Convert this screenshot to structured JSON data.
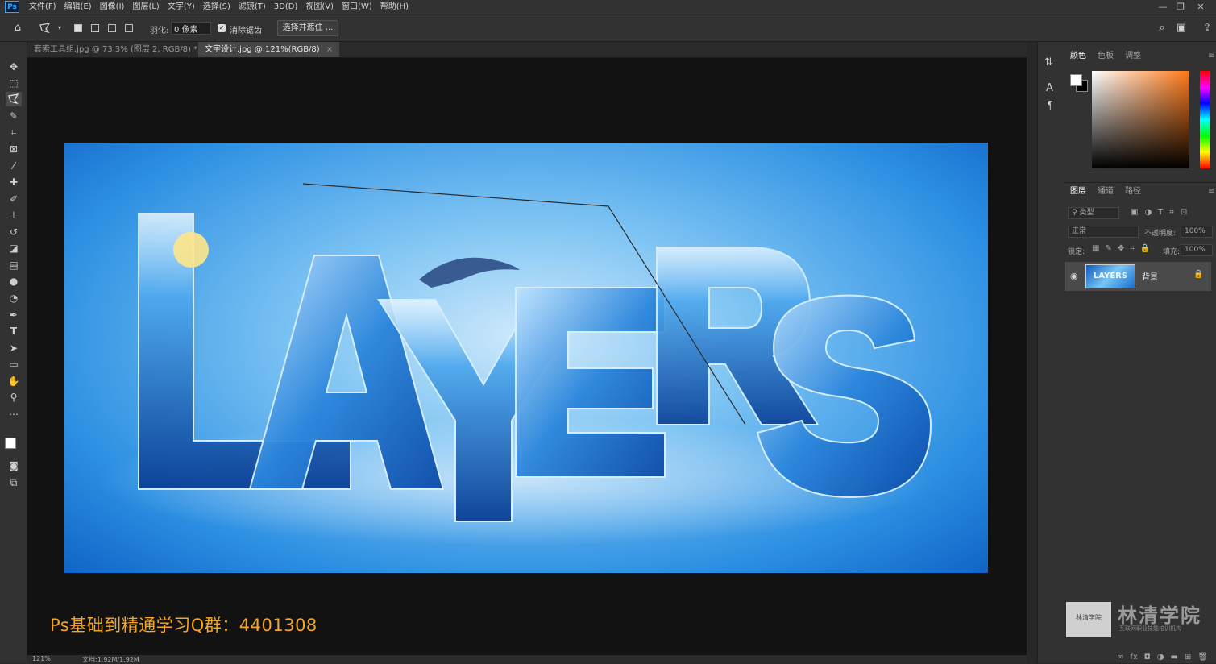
{
  "menubar": {
    "logo": "Ps",
    "items": [
      "文件(F)",
      "编辑(E)",
      "图像(I)",
      "图层(L)",
      "文字(Y)",
      "选择(S)",
      "滤镜(T)",
      "3D(D)",
      "视图(V)",
      "窗口(W)",
      "帮助(H)"
    ],
    "window_controls": [
      "—",
      "❐",
      "✕"
    ]
  },
  "options_bar": {
    "feather_label": "羽化:",
    "feather_value": "0 像素",
    "antialias_label": "消除锯齿",
    "antialias_checked": true,
    "select_mask_button": "选择并遮住 ..."
  },
  "documents": {
    "tabs": [
      {
        "label": "套索工具组.jpg @ 73.3% (图层 2, RGB/8) *",
        "active": false
      },
      {
        "label": "文字设计.jpg @ 121%(RGB/8)",
        "active": true
      }
    ],
    "close_glyph": "×"
  },
  "canvas": {
    "overlay_text": "Ps基础到精通学习Q群：4401308",
    "artwork_word": "LAYERS"
  },
  "status": {
    "zoom": "121%",
    "doc_size": "文档:1.92M/1.92M"
  },
  "color_panel": {
    "tabs": [
      "颜色",
      "色板",
      "调整"
    ],
    "active_tab": "颜色",
    "foreground": "#ffffff",
    "background": "#000000",
    "picker_hue": "#ff7a18"
  },
  "layers_panel": {
    "tabs": [
      "图层",
      "通道",
      "路径"
    ],
    "active_tab": "图层",
    "filter_placeholder": "类型",
    "blend_mode": "正常",
    "opacity_label": "不透明度:",
    "opacity_value": "100%",
    "lock_label": "锁定:",
    "fill_label": "填充:",
    "fill_value": "100%",
    "layers": [
      {
        "name": "背景",
        "visible": true,
        "locked": true,
        "thumb_text": "LAYERS"
      }
    ]
  },
  "watermark": {
    "seal_text": "林清学院",
    "title": "林清学院",
    "subtitle": "互联网职业技能培训机构"
  }
}
